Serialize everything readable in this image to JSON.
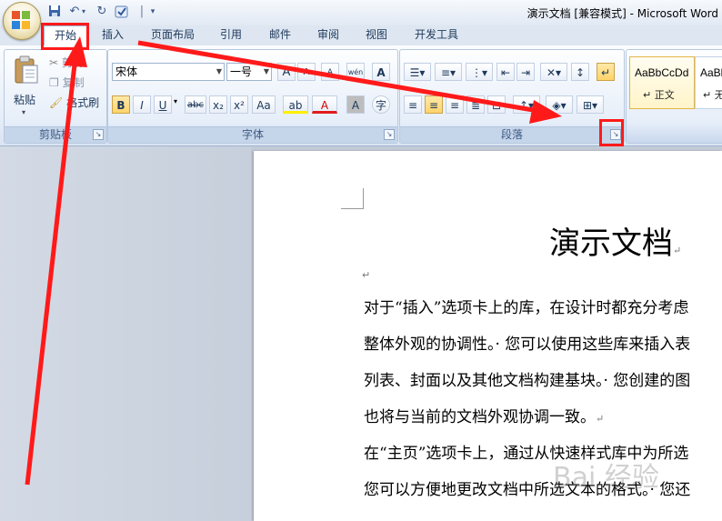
{
  "window": {
    "title": "演示文档 [兼容模式] - Microsoft Word"
  },
  "quick_access": {
    "save_icon": "save-icon",
    "undo_icon": "undo-icon",
    "redo_icon": "redo-icon",
    "separator": "|"
  },
  "tabs": [
    {
      "label": "开始"
    },
    {
      "label": "插入"
    },
    {
      "label": "页面布局"
    },
    {
      "label": "引用"
    },
    {
      "label": "邮件"
    },
    {
      "label": "审阅"
    },
    {
      "label": "视图"
    },
    {
      "label": "开发工具"
    }
  ],
  "clipboard": {
    "paste": "粘贴",
    "cut": "剪切",
    "copy": "复制",
    "format_painter": "格式刷",
    "group_label": "剪贴板"
  },
  "font": {
    "name": "宋体",
    "size": "一号",
    "grow": "A",
    "shrink": "A",
    "bold": "B",
    "italic": "I",
    "underline": "U",
    "strike": "abc",
    "subscript": "x₂",
    "superscript": "x²",
    "case": "Aa",
    "highlight": "ab",
    "color": "A",
    "char_shading": "A",
    "enclose": "字",
    "clear_format": "A",
    "phonetic": "wén",
    "char_border": "A",
    "group_label": "字体"
  },
  "paragraph": {
    "group_label": "段落"
  },
  "styles": {
    "items": [
      {
        "sample": "AaBbCcDd",
        "name": "↵ 正文"
      },
      {
        "sample": "AaBb",
        "name": "↵ 无"
      }
    ]
  },
  "document": {
    "title": "演示文档",
    "lines": [
      "对于“插入”选项卡上的库，在设计时都充分考虑",
      "整体外观的协调性。· 您可以使用这些库来插入表",
      "列表、封面以及其他文档构建基块。· 您创建的图",
      "也将与当前的文档外观协调一致。",
      "在“主页”选项卡上，通过从快速样式库中为所选",
      "您可以方便地更改文档中所选文本的格式。· 您还"
    ],
    "para_mark": "↵"
  },
  "watermark": "Bai 经验",
  "colors": {
    "annotation": "#ff1a1a",
    "accent": "#1e395b"
  }
}
